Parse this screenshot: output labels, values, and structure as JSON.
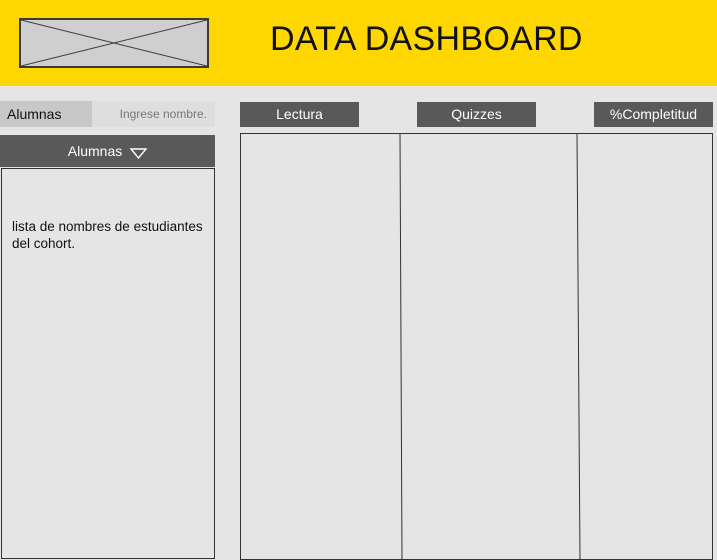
{
  "header": {
    "title": "DATA DASHBOARD",
    "logo_icon": "image-placeholder-icon",
    "background_color": "#ffd700"
  },
  "search": {
    "label": "Alumnas",
    "placeholder": "Ingrese nombre."
  },
  "dropdown": {
    "label": "Alumnas",
    "icon": "triangle-down-icon"
  },
  "student_list": {
    "text": "lista de nombres de estudiantes del cohort."
  },
  "columns": [
    {
      "label": "Lectura"
    },
    {
      "label": "Quizzes"
    },
    {
      "label": "%Completitud"
    }
  ]
}
